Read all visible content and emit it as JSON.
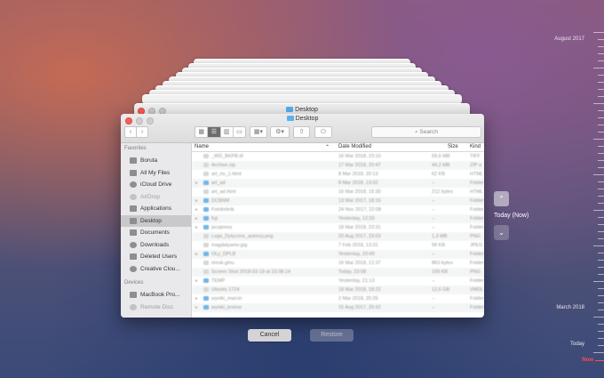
{
  "window": {
    "title": "Desktop",
    "ghost_title": "Desktop",
    "search_placeholder": "Search",
    "back_icon": "‹",
    "forward_icon": "›"
  },
  "sidebar": {
    "favorites_header": "Favorites",
    "favorites": [
      {
        "label": "Boruta",
        "icon": "home-icon"
      },
      {
        "label": "All My Files",
        "icon": "all-files-icon"
      },
      {
        "label": "iCloud Drive",
        "icon": "cloud-icon"
      },
      {
        "label": "AirDrop",
        "icon": "airdrop-icon"
      },
      {
        "label": "Applications",
        "icon": "applications-icon"
      },
      {
        "label": "Desktop",
        "icon": "desktop-icon"
      },
      {
        "label": "Documents",
        "icon": "documents-icon"
      },
      {
        "label": "Downloads",
        "icon": "downloads-icon"
      },
      {
        "label": "Deleted Users",
        "icon": "folder-icon"
      },
      {
        "label": "Creative Clou...",
        "icon": "creative-cloud-icon"
      }
    ],
    "devices_header": "Devices",
    "devices": [
      {
        "label": "MacBook Pro...",
        "icon": "laptop-icon"
      },
      {
        "label": "Remote Disc",
        "icon": "disc-icon"
      }
    ]
  },
  "columns": {
    "name": "Name",
    "date": "Date Modified",
    "size": "Size",
    "kind": "Kind"
  },
  "files": [
    {
      "name": "_WD_BKPB.tif",
      "date": "16 Mar 2018, 23:10",
      "size": "59,6 MB",
      "kind": "TIFF",
      "type": "doc"
    },
    {
      "name": "Archive.zip",
      "date": "17 Mar 2018, 20:47",
      "size": "44,2 MB",
      "kind": "ZIP a",
      "type": "doc"
    },
    {
      "name": "art_rio_1.html",
      "date": "8 Mar 2018, 20:13",
      "size": "62 KB",
      "kind": "HTML",
      "type": "doc"
    },
    {
      "name": "art_ad",
      "date": "8 Mar 2018, 13:02",
      "size": "--",
      "kind": "Folder",
      "type": "folder"
    },
    {
      "name": "art_ad.html",
      "date": "16 Mar 2018, 15:30",
      "size": "212 bytes",
      "kind": "HTML",
      "type": "doc"
    },
    {
      "name": "DCBNM",
      "date": "13 Mar 2017, 18:16",
      "size": "--",
      "kind": "Folder",
      "type": "folder"
    },
    {
      "name": "Fotobritnik",
      "date": "24 Nov 2017, 22:08",
      "size": "--",
      "kind": "Folder",
      "type": "folder"
    },
    {
      "name": "fuji",
      "date": "Yesterday, 12:20",
      "size": "--",
      "kind": "Folder",
      "type": "folder"
    },
    {
      "name": "jscopress",
      "date": "18 Mar 2018, 23:31",
      "size": "--",
      "kind": "Folder",
      "type": "folder"
    },
    {
      "name": "Logo_Dytyczne_autorzy.png",
      "date": "20 Aug 2017, 23:03",
      "size": "1,3 MB",
      "kind": "PNG",
      "type": "doc"
    },
    {
      "name": "magdalyamo.jpg",
      "date": "7 Feb 2018, 13:31",
      "size": "99 KB",
      "kind": "JPEG",
      "type": "doc"
    },
    {
      "name": "OLy_DPLB",
      "date": "Yesterday, 20:49",
      "size": "--",
      "kind": "Folder",
      "type": "folder"
    },
    {
      "name": "riresk.gmu",
      "date": "16 Mar 2018, 12:37",
      "size": "863 bytes",
      "kind": "Folder",
      "type": "doc"
    },
    {
      "name": "Screen Shot 2018-03-19 at 23.08.14",
      "date": "Today, 23:08",
      "size": "109 KB",
      "kind": "PNG",
      "type": "doc"
    },
    {
      "name": "TEMP",
      "date": "Yesterday, 21:13",
      "size": "--",
      "kind": "Folder",
      "type": "folder"
    },
    {
      "name": "Ubuntu 1724",
      "date": "18 Mar 2018, 18:22",
      "size": "12,6 GB",
      "kind": "VMDL",
      "type": "doc"
    },
    {
      "name": "wyniki_marcin",
      "date": "2 Mar 2018, 20:25",
      "size": "--",
      "kind": "Folder",
      "type": "folder"
    },
    {
      "name": "wyniki_testow",
      "date": "15 Aug 2017, 20:42",
      "size": "--",
      "kind": "Folder",
      "type": "folder"
    }
  ],
  "buttons": {
    "cancel": "Cancel",
    "restore": "Restore"
  },
  "time_machine": {
    "current": "Today (Now)",
    "up_icon": "⌃",
    "down_icon": "⌄"
  },
  "timeline": {
    "top": "August 2017",
    "mid": "March 2018",
    "today": "Today",
    "now": "Now"
  },
  "colors": {
    "now": "#ff4d4d",
    "selection": "#c9c9cc",
    "folder": "#5bb1ef"
  }
}
